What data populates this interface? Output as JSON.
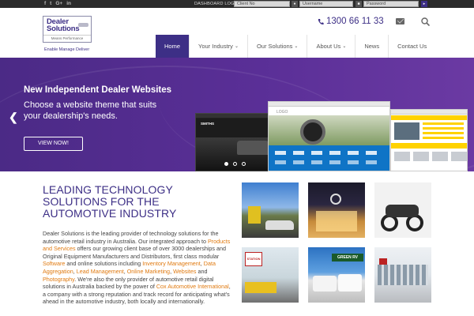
{
  "topbar": {
    "social": [
      "f",
      "t",
      "G+",
      "in"
    ],
    "dashboard_label": "DASHBOARD LOGIN",
    "client_placeholder": "Client No",
    "username_placeholder": "Username",
    "password_placeholder": "Password"
  },
  "header": {
    "logo_line1": "Dealer",
    "logo_line2": "Solutions",
    "logo_tag": "Means Performance",
    "tagline": "Enable Manage Deliver",
    "phone": "1300 66 11 33"
  },
  "nav": {
    "items": [
      {
        "label": "Home",
        "dropdown": false
      },
      {
        "label": "Your Industry",
        "dropdown": true
      },
      {
        "label": "Our Solutions",
        "dropdown": true
      },
      {
        "label": "About Us",
        "dropdown": true
      },
      {
        "label": "News",
        "dropdown": false
      },
      {
        "label": "Contact Us",
        "dropdown": false
      }
    ]
  },
  "hero": {
    "title": "New Independent Dealer Websites",
    "subtitle": "Choose a website theme that suits your dealership's needs.",
    "button": "VIEW NOW!",
    "mock1_brand": "SMITHS",
    "mock2_brand": "LOGO"
  },
  "content": {
    "heading_lines": [
      "LEADING TECHNOLOGY",
      "SOLUTIONS FOR THE",
      "AUTOMOTIVE INDUSTRY"
    ],
    "p1": "Dealer Solutions is the leading provider of technology solutions for the automotive retail industry in Australia. Our integrated approach to ",
    "link1": "Products and Services",
    "p2": " offers our growing client base of over 3000 dealerships and Original Equipment Manufacturers and Distributors, first class modular ",
    "link2": "Software",
    "p3": " and online solutions including ",
    "link3": "Inventory Management",
    "sep1": ", ",
    "link4": "Data Aggregation",
    "sep2": ", ",
    "link5": "Lead Management",
    "sep3": ", ",
    "link6": "Online Marketing",
    "sep4": ", ",
    "link7": "Websites",
    "p4": " and ",
    "link8": "Photography",
    "p5": ". We're also the only provider of automotive retail digital solutions in Australia backed by the power of ",
    "link9": "Cox Automotive International",
    "p6": ", a company with a strong reputation and track record for anticipating what's ahead in the automotive industry, both locally and internationally."
  },
  "photos": {
    "sign1": "STATION",
    "sign2": "GREEN RV"
  },
  "colors": {
    "brand_purple": "#3d2f86",
    "link_orange": "#e07a10",
    "topbar": "#2b2b2b"
  }
}
